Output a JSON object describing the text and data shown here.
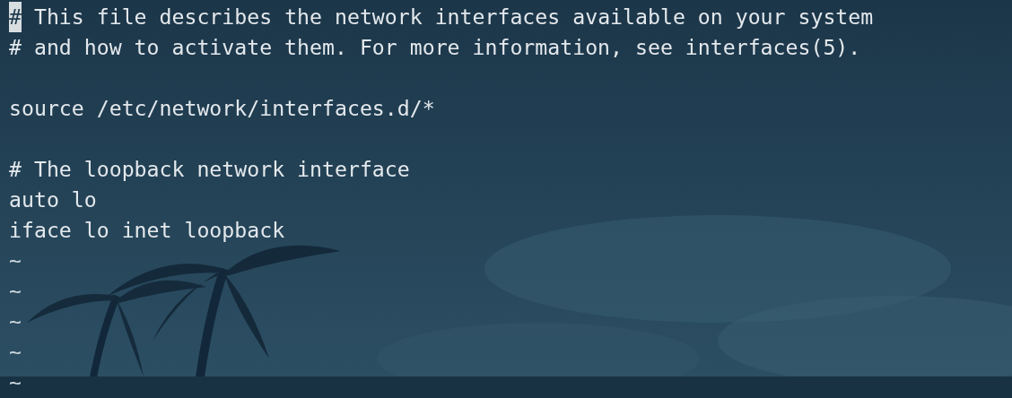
{
  "editor": {
    "lines": [
      {
        "kind": "text",
        "text": "# This file describes the network interfaces available on your system",
        "cursor": true
      },
      {
        "kind": "text",
        "text": "# and how to activate them. For more information, see interfaces(5).",
        "cursor": false
      },
      {
        "kind": "blank"
      },
      {
        "kind": "text",
        "text": "source /etc/network/interfaces.d/*",
        "cursor": false
      },
      {
        "kind": "blank"
      },
      {
        "kind": "text",
        "text": "# The loopback network interface",
        "cursor": false
      },
      {
        "kind": "text",
        "text": "auto lo",
        "cursor": false
      },
      {
        "kind": "text",
        "text": "iface lo inet loopback",
        "cursor": false
      },
      {
        "kind": "tilde",
        "text": "~"
      },
      {
        "kind": "tilde",
        "text": "~"
      },
      {
        "kind": "tilde",
        "text": "~"
      },
      {
        "kind": "tilde",
        "text": "~"
      },
      {
        "kind": "tilde",
        "text": "~"
      }
    ]
  }
}
